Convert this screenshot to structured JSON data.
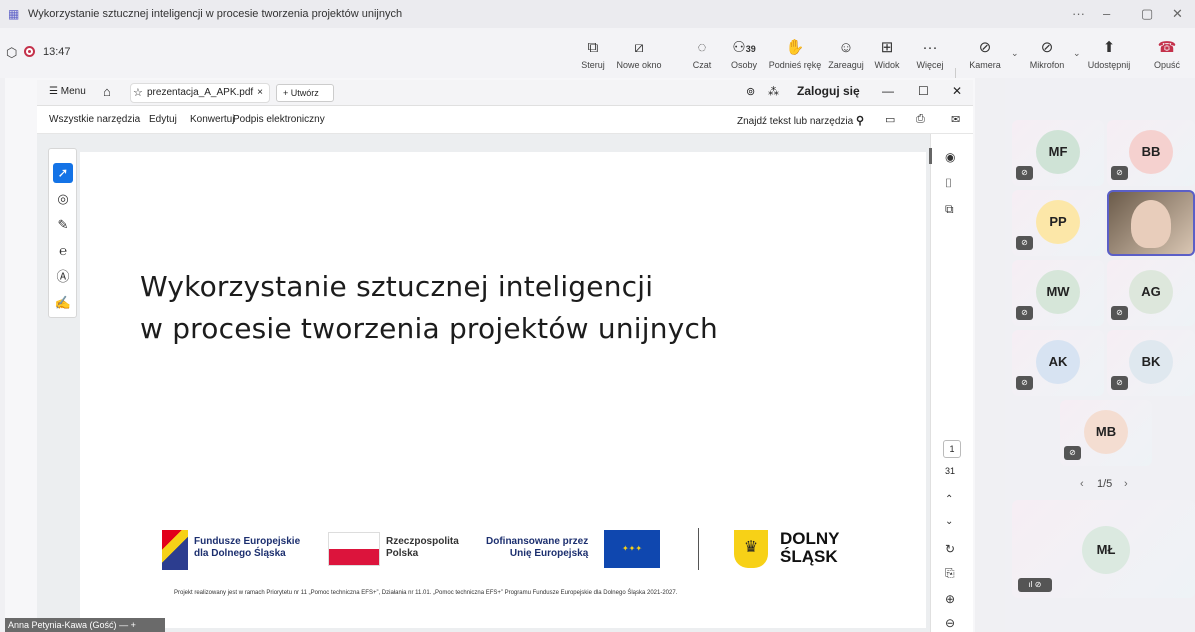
{
  "window": {
    "title": "Wykorzystanie sztucznej inteligencji w procesie tworzenia projektów unijnych",
    "controls": [
      "···",
      "–",
      "▢",
      "✕"
    ]
  },
  "meeting": {
    "time": "13:47",
    "toolbar": [
      {
        "id": "steruj",
        "label": "Steruj",
        "icon": "control-icon"
      },
      {
        "id": "nowe",
        "label": "Nowe okno",
        "icon": "new-window-icon"
      },
      {
        "id": "czat",
        "label": "Czat",
        "icon": "chat-icon"
      },
      {
        "id": "osoby",
        "label": "Osoby",
        "icon": "people-icon",
        "count": "39"
      },
      {
        "id": "reka",
        "label": "Podnieś rękę",
        "icon": "raise-hand-icon"
      },
      {
        "id": "zareaguj",
        "label": "Zareaguj",
        "icon": "react-icon"
      },
      {
        "id": "widok",
        "label": "Widok",
        "icon": "view-icon"
      },
      {
        "id": "wiecej",
        "label": "Więcej",
        "icon": "more-icon"
      },
      {
        "id": "kamera",
        "label": "Kamera",
        "icon": "camera-off-icon"
      },
      {
        "id": "mikrofon",
        "label": "Mikrofon",
        "icon": "mic-off-icon"
      },
      {
        "id": "udostepnij",
        "label": "Udostępnij",
        "icon": "share-icon"
      },
      {
        "id": "opusc",
        "label": "Opuść",
        "icon": "hangup-icon"
      }
    ]
  },
  "pdf": {
    "menu": "Menu",
    "tab": "prezentacja_A_APK.pdf",
    "new_tab": "Utwórz",
    "login": "Zaloguj się",
    "menu_items": [
      "Wszystkie narzędzia",
      "Edytuj",
      "Konwertuj",
      "Podpis elektroniczny"
    ],
    "search": "Znajdź tekst lub narzędzia",
    "page_current": "1",
    "page_total": "31"
  },
  "slide": {
    "title_line1": "Wykorzystanie sztucznej inteligencji",
    "title_line2": "w procesie tworzenia projektów unijnych",
    "logo1_line1": "Fundusze Europejskie",
    "logo1_line2": "dla Dolnego Śląska",
    "logo2_line1": "Rzeczpospolita",
    "logo2_line2": "Polska",
    "logo3_line1": "Dofinansowane przez",
    "logo3_line2": "Unię Europejską",
    "logo4_line1": "DOLNY",
    "logo4_line2": "ŚLĄSK",
    "footer": "Projekt realizowany jest w ramach Priorytetu nr 11 „Pomoc techniczna EFS+”, Działania nr 11.01. „Pomoc techniczna EFS+” Programu Fundusze Europejskie dla Dolnego Śląska 2021-2027."
  },
  "participants": [
    "MF",
    "BB",
    "PP",
    "MW",
    "AG",
    "AK",
    "BK",
    "MB",
    "MŁ"
  ],
  "pager": "1/5",
  "presenter": "Anna Petynia-Kawa (Gość)"
}
